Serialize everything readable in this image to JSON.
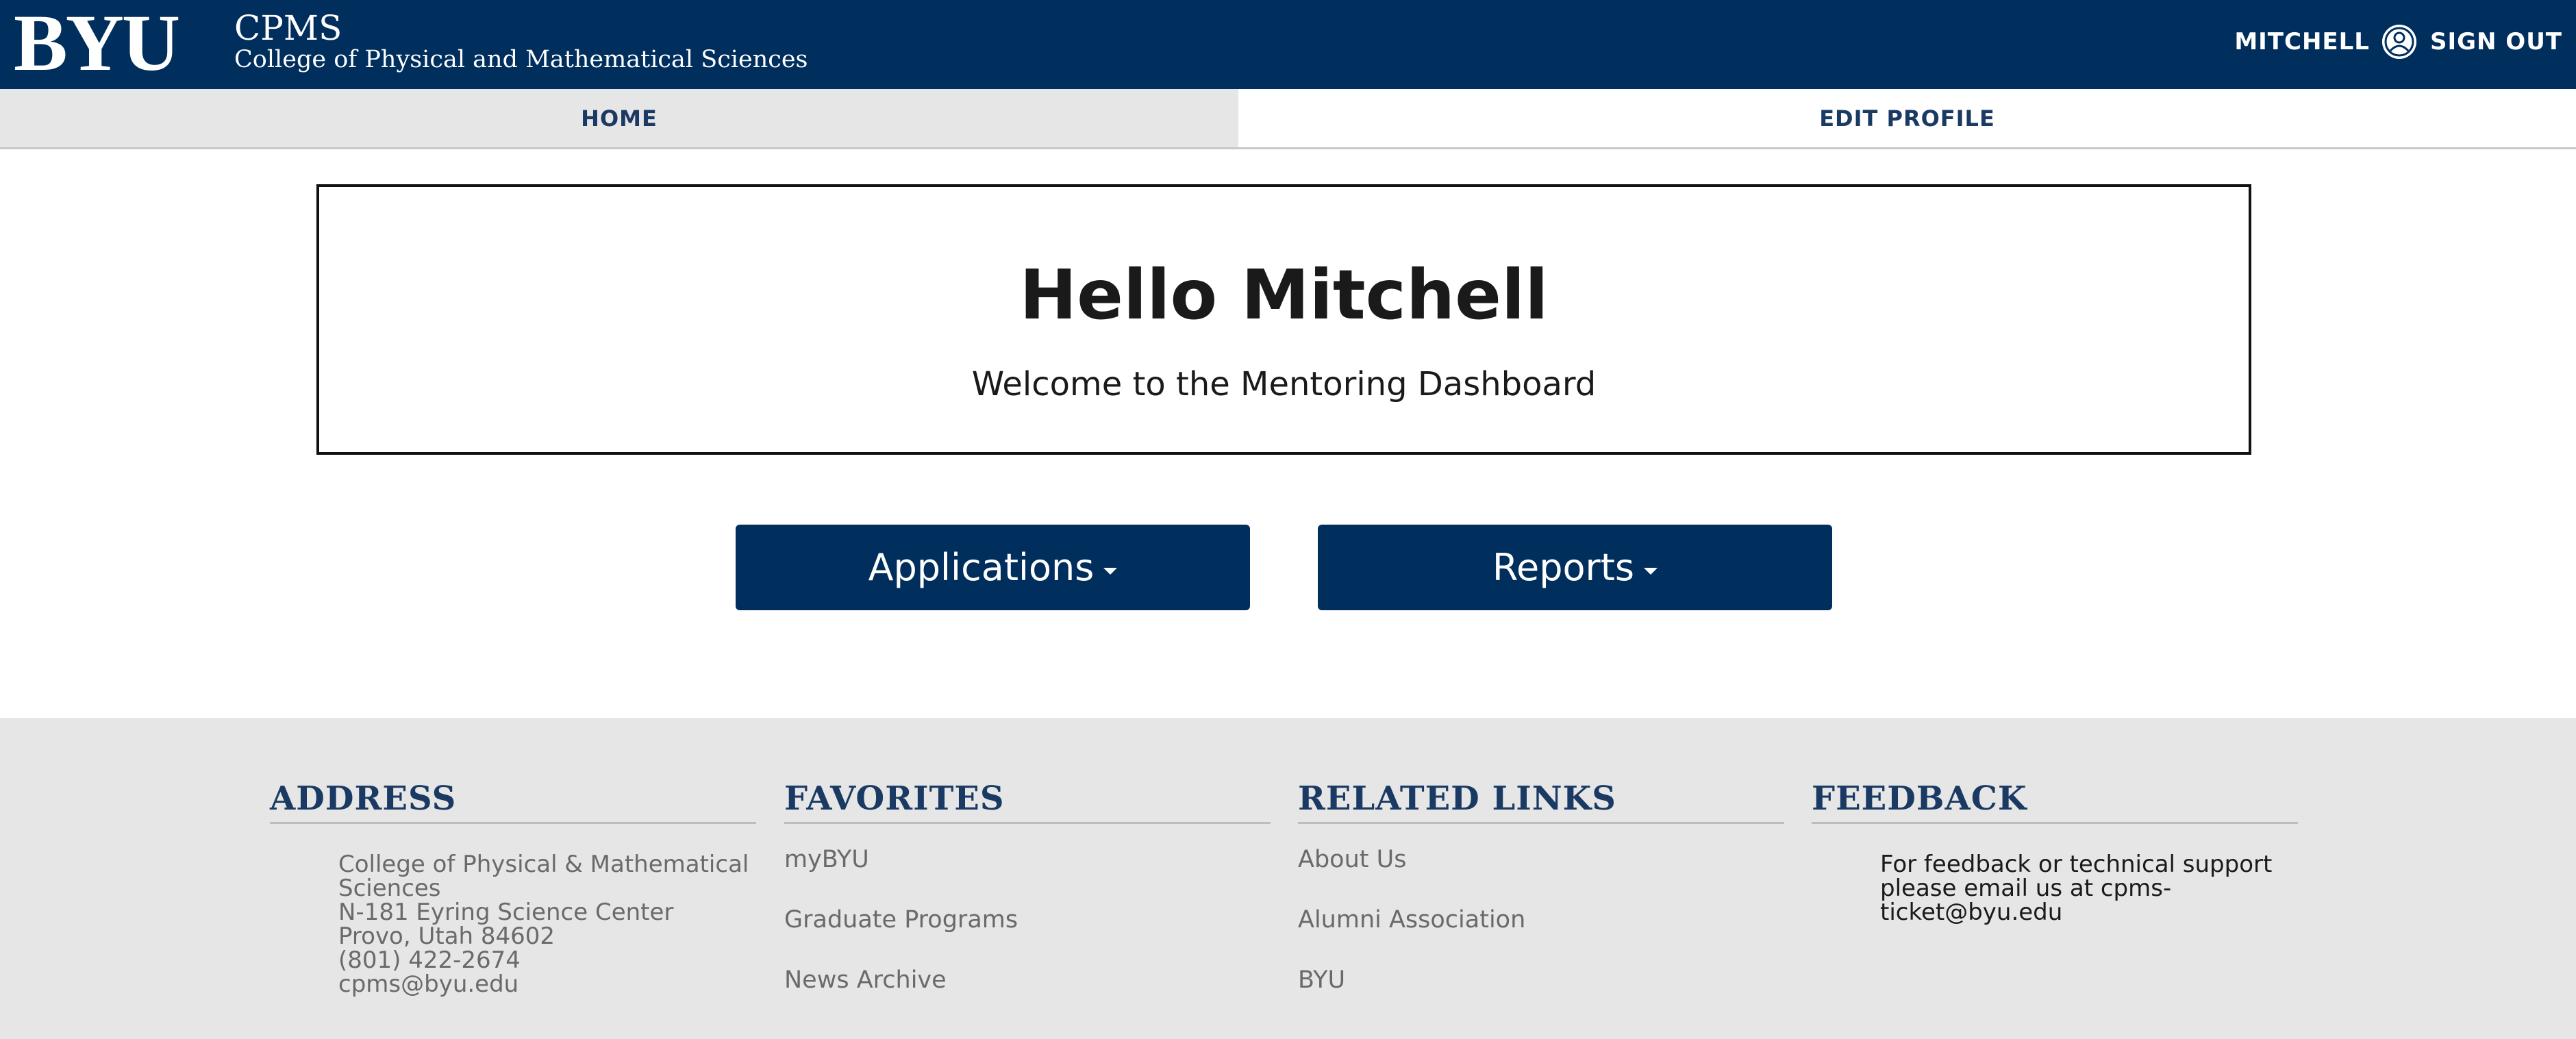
{
  "header": {
    "logo": "BYU",
    "site_name": "CPMS",
    "site_subtitle": "College of Physical and Mathematical Sciences",
    "user_name": "MITCHELL",
    "sign_out": "SIGN OUT",
    "user_icon": "user-circle-icon"
  },
  "nav": {
    "tabs": [
      {
        "label": "HOME",
        "active": false
      },
      {
        "label": "EDIT PROFILE",
        "active": true
      }
    ]
  },
  "welcome": {
    "title": "Hello Mitchell",
    "subtitle": "Welcome to the Mentoring Dashboard"
  },
  "buttons": {
    "applications": "Applications",
    "reports": "Reports"
  },
  "footer": {
    "address": {
      "heading": "ADDRESS",
      "lines": [
        "College of Physical & Mathematical",
        "Sciences",
        "N-181 Eyring Science Center",
        "Provo, Utah 84602",
        "(801) 422-2674",
        "cpms@byu.edu"
      ]
    },
    "favorites": {
      "heading": "FAVORITES",
      "links": [
        "myBYU",
        "Graduate Programs",
        "News Archive"
      ]
    },
    "related_links": {
      "heading": "RELATED LINKS",
      "links": [
        "About Us",
        "Alumni Association",
        "BYU"
      ]
    },
    "feedback": {
      "heading": "FEEDBACK",
      "text": "For feedback or technical support please email us at cpms-ticket@byu.edu"
    }
  },
  "colors": {
    "brand_navy": "#002e5d",
    "tab_inactive_bg": "#e6e6e6",
    "footer_bg": "#e6e6e6",
    "heading_navy": "#1a3a63",
    "muted_text": "#6a6a6a"
  }
}
